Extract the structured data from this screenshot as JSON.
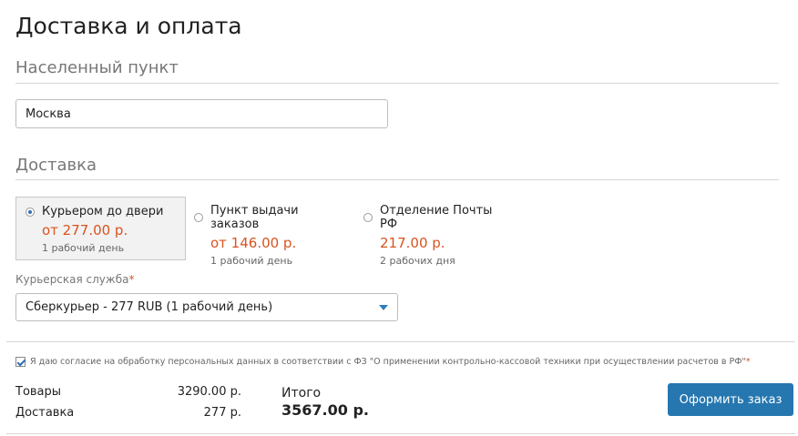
{
  "page": {
    "title": "Доставка и оплата"
  },
  "city": {
    "section_title": "Населенный пункт",
    "value": "Москва"
  },
  "delivery": {
    "section_title": "Доставка",
    "options": [
      {
        "name": "Курьером до двери",
        "price": "от 277.00 р.",
        "days": "1 рабочий день",
        "selected": true
      },
      {
        "name": "Пункт выдачи заказов",
        "price": "от 146.00 р.",
        "days": "1 рабочий день",
        "selected": false
      },
      {
        "name": "Отделение Почты РФ",
        "price": "217.00 р.",
        "days": "2 рабочих дня",
        "selected": false
      }
    ],
    "courier_label": "Курьерская служба",
    "required_mark": "*",
    "courier_selected": "Сберкурьер - 277 RUB (1 рабочий день)"
  },
  "consent": {
    "checked": true,
    "text": "Я даю согласие на обработку персональных данных в соответствии с ФЗ \"О применении контрольно-кассовой техники при осуществлении расчетов в РФ\"",
    "required_mark": "*"
  },
  "totals": {
    "goods_label": "Товары",
    "goods_value": "3290.00 р.",
    "delivery_label": "Доставка",
    "delivery_value": "277 р.",
    "total_label": "Итого",
    "total_value": "3567.00 р."
  },
  "order_button": {
    "label": "Оформить заказ"
  },
  "colors": {
    "accent": "#2677b0",
    "price": "#d9531e",
    "muted": "#777777"
  }
}
